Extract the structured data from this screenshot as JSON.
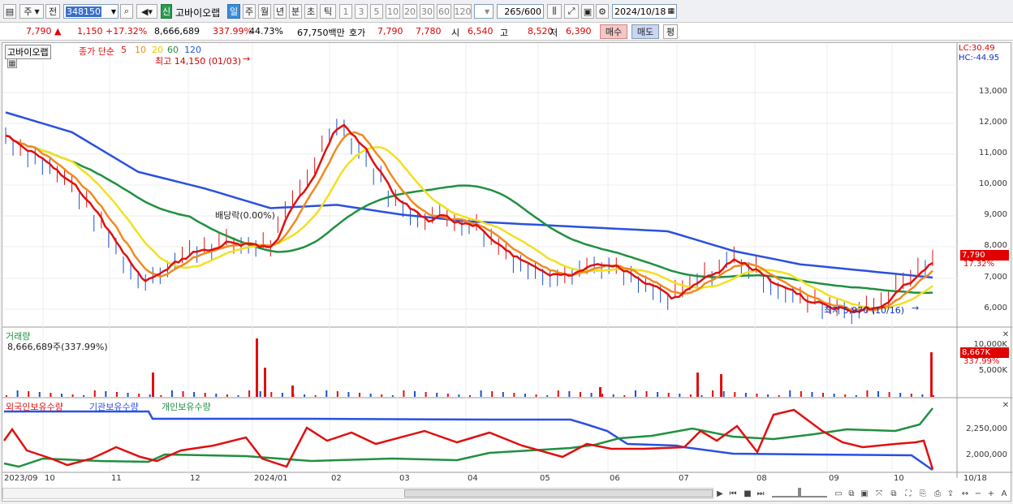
{
  "toolbar": {
    "market": "주",
    "prev_label": "전",
    "code": "348150",
    "new_badge": "신",
    "stock_name": "고바이오랩",
    "period_tabs": [
      "일",
      "주",
      "월",
      "년",
      "분",
      "초",
      "틱"
    ],
    "selected_period": "일",
    "intervals": [
      "1",
      "3",
      "5",
      "10",
      "20",
      "30",
      "60",
      "120"
    ],
    "count": "265",
    "count_total": "/600",
    "date": "2024/10/18"
  },
  "quote": {
    "price": "7,790",
    "change": "1,150",
    "change_pct": "+17.32%",
    "volume": "8,666,689",
    "volume_pct": "337.99%",
    "turnover": "44.73%",
    "amount": "67,750백만",
    "hoga_label": "호가",
    "ask": "7,790",
    "bid": "7,780",
    "open_label": "시",
    "open": "6,540",
    "high_label": "고",
    "high": "8,520",
    "low_label": "저",
    "low": "6,390",
    "buy_label": "매수",
    "sell_label": "매도",
    "eval_label": "평"
  },
  "price_panel": {
    "name_tag": "고바이오랩",
    "ma_title": "종가 단순",
    "ma_periods": [
      "5",
      "10",
      "20",
      "60",
      "120"
    ],
    "ma_colors": [
      "#e01010",
      "#f08a20",
      "#f2e020",
      "#1f9040",
      "#2a50e0"
    ],
    "high_note": "최고 14,150 (01/03)",
    "low_note": "최저 5,970 (10/16)",
    "dividend_note": "배당락(0.00%)",
    "lc": "LC:30.49",
    "hc": "HC:-44.95",
    "current_price": "7,790",
    "current_pct": "17.32%",
    "y_ticks": [
      "13,000",
      "12,000",
      "11,000",
      "10,000",
      "9,000",
      "8,000",
      "7,000",
      "6,000"
    ]
  },
  "volume_panel": {
    "title": "거래량",
    "value": "8,666,689주(337.99%)",
    "y_ticks": [
      "10,000K",
      "5,000K"
    ],
    "current": "8,667K",
    "current_pct": "337.99%"
  },
  "holdings_panel": {
    "legend": [
      "외국인보유수량",
      "기관보유수량",
      "개인보유수량"
    ],
    "legend_colors": [
      "#e01010",
      "#2a50e0",
      "#1f9040"
    ],
    "y_ticks": [
      "2,250,000",
      "2,000,000"
    ]
  },
  "x_axis": [
    "2023/09",
    "10",
    "11",
    "12",
    "2024/01",
    "02",
    "03",
    "04",
    "05",
    "06",
    "07",
    "08",
    "09",
    "10",
    "10/18"
  ],
  "chart_data": {
    "type": "line",
    "title": "",
    "xlabel": "",
    "ylabel": "",
    "ylim": [
      5700,
      14300
    ],
    "x": [
      "2023/09",
      "2023/10",
      "2023/11",
      "2023/12",
      "2024/01",
      "2024/02",
      "2024/03",
      "2024/04",
      "2024/05",
      "2024/06",
      "2024/07",
      "2024/08",
      "2024/09",
      "2024/10",
      "2024/10/18"
    ],
    "series": [
      {
        "name": "5",
        "values": [
          11500,
          10000,
          7100,
          8200,
          8200,
          12000,
          9200,
          8900,
          7300,
          7600,
          6500,
          7800,
          6500,
          6200,
          7790
        ]
      },
      {
        "name": "120",
        "values": [
          12200,
          11600,
          10400,
          9900,
          9300,
          9400,
          9100,
          8900,
          8800,
          8700,
          8600,
          8000,
          7600,
          7400,
          7200
        ]
      }
    ]
  }
}
